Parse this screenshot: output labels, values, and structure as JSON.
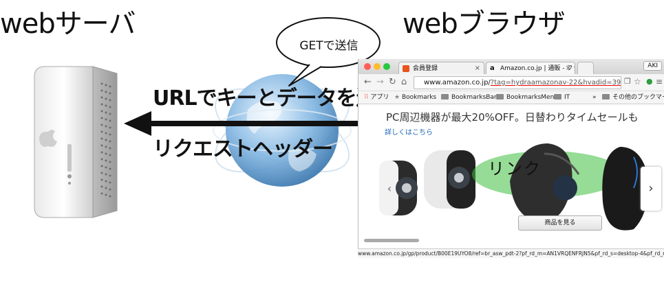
{
  "headings": {
    "server": "webサーバ",
    "browser": "webブラウザ"
  },
  "bubble": {
    "text": "GETで送信"
  },
  "arrow_labels": {
    "top": "URLでキーとデータを送信",
    "bottom": "リクエストヘッダー"
  },
  "browser": {
    "tabs": [
      {
        "label": "会員登録",
        "close": "×"
      },
      {
        "label": "Amazon.co.jp | 通販 - ファ",
        "close": "×"
      }
    ],
    "user_badge": "AKI",
    "url": {
      "host": "www.amazon.co.jp/",
      "query": "?tag=hydraamazonav-22&hvadid=395..."
    },
    "bookmarks": {
      "apps": "アプリ",
      "items": [
        "Bookmarks",
        "BookmarksBar",
        "BookmarksMenu",
        "IT"
      ],
      "more": "»",
      "other": "その他のブックマーク"
    },
    "promo_text": "PC周辺機器が最大20%OFF。日替わりタイムセールも",
    "detail_link": "詳しくはこちら",
    "link_label": "リンク",
    "view_button": "商品を見る",
    "carousel_prev": "‹",
    "carousel_next": "›"
  },
  "status_url": "www.amazon.co.jp/gp/product/B00E19UYO8/ref=br_asw_pdt-2?pf_rd_m=AN1VRQENFRJN5&pf_rd_s=desktop-4&pf_rd_r=...",
  "colors": {
    "arrow": "#111111",
    "link_highlight": "#3fbf3f",
    "url_underline": "#e00000",
    "globe": "#4a8fc7"
  },
  "icons": [
    "server-icon",
    "globe-icon",
    "speech-bubble-icon",
    "arrow-left-icon"
  ]
}
